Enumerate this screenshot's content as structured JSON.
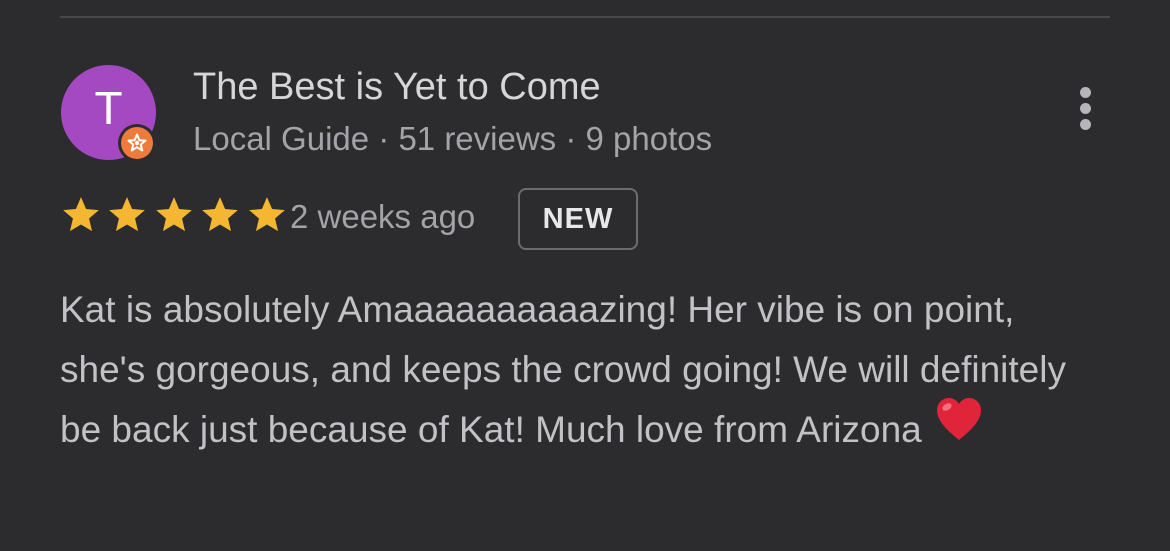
{
  "reviewer": {
    "avatar_letter": "T",
    "avatar_color": "#a549c2",
    "badge_color": "#ee7a3c",
    "badge_icon": "local-guide-star-icon",
    "name": "The Best is Yet to Come",
    "meta": "Local Guide · 51 reviews · 9 photos"
  },
  "review": {
    "rating": 5,
    "rating_max": 5,
    "star_color": "#f5b731",
    "timestamp": "2 weeks ago",
    "badge": "NEW",
    "text": "Kat is absolutely Amaaaaaaaaaazing! Her vibe is on point, she's gorgeous, and keeps the crowd going! We will definitely be back just because of Kat! Much love from Arizona",
    "emoji_icon": "red-heart-icon"
  },
  "menu_icon": "more-vertical-icon"
}
